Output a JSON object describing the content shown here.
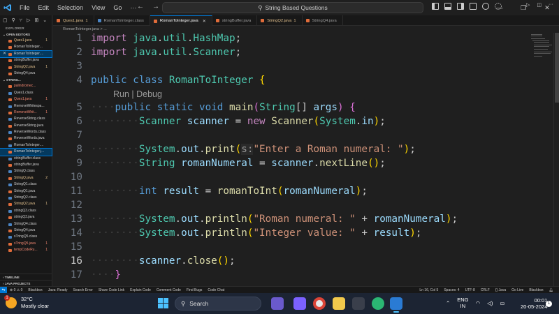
{
  "window": {
    "menu": [
      "File",
      "Edit",
      "Selection",
      "View",
      "Go"
    ],
    "menu_more": "···",
    "search": "String Based Questions"
  },
  "sidebar": {
    "title": "EXPLORER",
    "open_editors_header": "OPEN EDITORS",
    "open_editors": [
      {
        "name": "Ques1.java",
        "badge": "1",
        "state": "modified"
      },
      {
        "name": "RomanToInteger...",
        "state": "normal"
      },
      {
        "name": "RomanToInteger....",
        "state": "active"
      },
      {
        "name": "stringBuffer.java",
        "state": "normal"
      },
      {
        "name": "StringQ2.java",
        "badge": "1",
        "state": "modified"
      },
      {
        "name": "StringQ4.java",
        "state": "normal"
      }
    ],
    "folder_header": "STRING...",
    "files": [
      {
        "name": "palindromec...",
        "state": "error",
        "type": "java"
      },
      {
        "name": "Ques1.class",
        "state": "normal",
        "type": "class"
      },
      {
        "name": "Ques1.java",
        "badge": "1",
        "state": "error",
        "type": "java"
      },
      {
        "name": "RemoveWhitespa...",
        "state": "normal",
        "type": "class"
      },
      {
        "name": "RemoveWhit...",
        "badge": "1",
        "state": "error",
        "type": "java"
      },
      {
        "name": "ReverseString.class",
        "state": "normal",
        "type": "class"
      },
      {
        "name": "ReverseString.java",
        "state": "normal",
        "type": "java"
      },
      {
        "name": "ReverseWords.class",
        "state": "normal",
        "type": "class"
      },
      {
        "name": "ReverseWords.java",
        "state": "normal",
        "type": "java"
      },
      {
        "name": "RomanToInteger....",
        "state": "normal",
        "type": "class"
      },
      {
        "name": "RomanToInteger.j...",
        "state": "active",
        "type": "java"
      },
      {
        "name": "stringBuffer.class",
        "state": "normal",
        "type": "class"
      },
      {
        "name": "stringBuffer.java",
        "state": "normal",
        "type": "java"
      },
      {
        "name": "StringQ.class",
        "state": "normal",
        "type": "class"
      },
      {
        "name": "StringQ.java",
        "badge": "2",
        "state": "modified",
        "type": "java"
      },
      {
        "name": "StringQ1.class",
        "state": "normal",
        "type": "class"
      },
      {
        "name": "StringQ1.java",
        "state": "normal",
        "type": "java"
      },
      {
        "name": "StringQ2.class",
        "state": "normal",
        "type": "class"
      },
      {
        "name": "StringQ2.java",
        "badge": "1",
        "state": "modified",
        "type": "java"
      },
      {
        "name": "stringQ3.class",
        "state": "normal",
        "type": "class"
      },
      {
        "name": "stringQ3.java",
        "state": "normal",
        "type": "java"
      },
      {
        "name": "StringQ4.class",
        "state": "normal",
        "type": "class"
      },
      {
        "name": "StringQ4.java",
        "state": "normal",
        "type": "java"
      },
      {
        "name": "sTringQ5.class",
        "state": "normal",
        "type": "class"
      },
      {
        "name": "sTringQ5.java",
        "badge": "1",
        "state": "error",
        "type": "java"
      },
      {
        "name": "tempCodeRu...",
        "badge": "1",
        "state": "error",
        "type": "java"
      }
    ],
    "timeline": "TIMELINE",
    "java_projects": "JAVA PROJECTS"
  },
  "tabs": [
    {
      "label": "Ques1.java",
      "badge": "1",
      "state": "modified",
      "type": "java"
    },
    {
      "label": "RomanToInteger.class",
      "state": "normal",
      "type": "class"
    },
    {
      "label": "RomanToInteger.java",
      "state": "active",
      "type": "java"
    },
    {
      "label": "stringBuffer.java",
      "state": "normal",
      "type": "java"
    },
    {
      "label": "StringQ2.java",
      "badge": "1",
      "state": "modified",
      "type": "java"
    },
    {
      "label": "StringQ4.java",
      "state": "normal",
      "type": "java"
    }
  ],
  "breadcrumb": "RomanToInteger.java > ...",
  "editor": {
    "codelens": "Run | Debug",
    "current_line": 16,
    "line_numbers": [
      "1",
      "2",
      "3",
      "4",
      "5",
      "6",
      "7",
      "8",
      "9",
      "10",
      "11",
      "12",
      "13",
      "14",
      "15",
      "16",
      "17"
    ]
  },
  "statusbar": {
    "errors": "0",
    "warnings": "0",
    "items_left": [
      "Blackbox",
      "Java: Ready",
      "Search Error",
      "Share Code Link",
      "Explain Code",
      "Comment Code",
      "Find Bugs",
      "Code Chat"
    ],
    "items_right": [
      "Ln 16, Col 5",
      "Spaces: 4",
      "UTF-8",
      "CRLF",
      "{} Java",
      "Go Live",
      "Blackbox"
    ]
  },
  "taskbar": {
    "temperature": "32°C",
    "weather": "Mostly clear",
    "weather_badge": "1",
    "search_label": "Search",
    "lang_primary": "ENG",
    "lang_secondary": "IN",
    "time": "00:01",
    "date": "20-05-2024",
    "notifications": "1"
  }
}
